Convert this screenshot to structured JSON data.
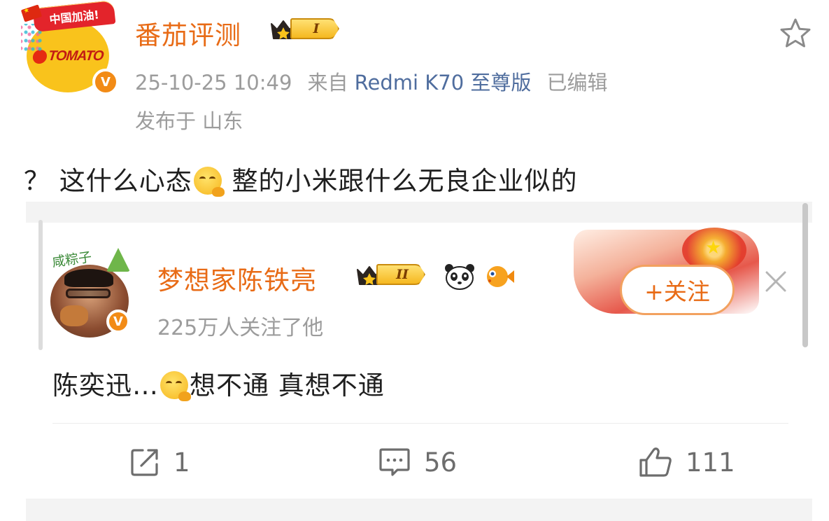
{
  "post": {
    "author": {
      "name": "番茄评测",
      "level": "I",
      "avatar_banner": "中国加油!",
      "avatar_brand": "TOMATO",
      "verified": true
    },
    "meta": {
      "time": "25-10-25 10:49",
      "source_prefix": "来自",
      "device": "Redmi K70 至尊版",
      "edited": "已编辑",
      "location_prefix": "发布于",
      "location": "山东"
    },
    "text_before_emoji": "？ 这什么心态",
    "text_after_emoji": " 整的小米跟什么无良企业似的"
  },
  "repost": {
    "author": {
      "name": "梦想家陈铁亮",
      "level": "II",
      "avatar_tag": "咸粽子",
      "followers": "225万人关注了他",
      "verified": true
    },
    "follow_label": "+关注",
    "text_before_emoji": "陈奕迅…",
    "text_after_emoji": "想不通 真想不通"
  },
  "actions": {
    "repost_count": "1",
    "comment_count": "56",
    "like_count": "111"
  },
  "icons": {
    "favorite": "star-icon",
    "close": "close-icon",
    "repost": "share-icon",
    "comment": "comment-icon",
    "like": "thumbs-up-icon"
  },
  "colors": {
    "name_orange": "#e86b16",
    "device_blue": "#4f6d9e",
    "meta_gray": "#9c9c9c",
    "verified_orange": "#f28b16"
  }
}
